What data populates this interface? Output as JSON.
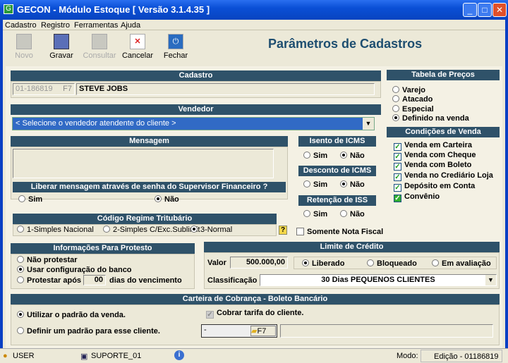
{
  "window": {
    "title": "GECON  -  Módulo Estoque     [ Versão 3.1.4.35 ]",
    "logo": "G"
  },
  "menu": [
    "Cadastro",
    "Registro",
    "Ferramentas",
    "Ajuda"
  ],
  "toolbar": [
    {
      "label": "Novo",
      "icon": "new-icon",
      "enabled": false
    },
    {
      "label": "Gravar",
      "icon": "floppy-icon",
      "enabled": true
    },
    {
      "label": "Consultar",
      "icon": "search-icon",
      "enabled": false
    },
    {
      "label": "Cancelar",
      "icon": "cancel-doc-icon",
      "enabled": true
    },
    {
      "label": "Fechar",
      "icon": "power-icon",
      "enabled": true
    }
  ],
  "page_title": "Parâmetros de Cadastros",
  "cadastro": {
    "header": "Cadastro",
    "code": "01-186819",
    "key": "F7",
    "name": "STEVE JOBS"
  },
  "vendedor": {
    "header": "Vendedor",
    "selected": "< Selecione o vendedor atendente do cliente >"
  },
  "mensagem": {
    "header": "Mensagem",
    "text": ""
  },
  "liberar": {
    "header": "Liberar mensagem através de senha do Supervisor Financeiro ?",
    "options": [
      "Sim",
      "Não"
    ],
    "selected": "Não"
  },
  "isento_icms": {
    "header": "Isento de ICMS",
    "options": [
      "Sim",
      "Não"
    ],
    "selected": "Não"
  },
  "desconto_icms": {
    "header": "Desconto de ICMS",
    "options": [
      "Sim",
      "Não"
    ],
    "selected": "Não"
  },
  "retencao_iss": {
    "header": "Retenção de ISS",
    "options": [
      "Sim",
      "Não"
    ],
    "selected": null
  },
  "tabela_precos": {
    "header": "Tabela de Preços",
    "options": [
      "Varejo",
      "Atacado",
      "Especial",
      "Definido na venda"
    ],
    "selected": "Definido na venda"
  },
  "condicoes_venda": {
    "header": "Condições de Venda",
    "items": [
      {
        "label": "Venda em Carteira",
        "checked": true
      },
      {
        "label": "Venda com Cheque",
        "checked": true
      },
      {
        "label": "Venda com Boleto",
        "checked": true
      },
      {
        "label": "Venda no Crediário Loja",
        "checked": true
      },
      {
        "label": "Depósito em Conta",
        "checked": true
      },
      {
        "label": "Convênio",
        "checked": true
      }
    ]
  },
  "regime": {
    "header": "Código Regime Tritubário",
    "options": [
      "1-Simples Nacional",
      "2-Simples C/Exc.Sublimit",
      "3-Normal"
    ],
    "selected": "3-Normal",
    "help": "?"
  },
  "somente_nota": {
    "label": "Somente Nota Fiscal",
    "checked": false
  },
  "protesto": {
    "header": "Informações Para Protesto",
    "opt1": "Não protestar",
    "opt2": "Usar configuração do banco",
    "opt3": "Protestar após",
    "days": "00",
    "suffix": "dias do vencimento",
    "selected": "Usar configuração do banco"
  },
  "limite": {
    "header": "Limite de Crédito",
    "valor_label": "Valor",
    "valor": "500.000,00",
    "options": [
      "Liberado",
      "Bloqueado",
      "Em avaliação"
    ],
    "selected": "Liberado",
    "class_label": "Classificação",
    "classificacao": "30 Dias  PEQUENOS CLIENTES"
  },
  "carteira": {
    "header": "Carteira de Cobrança - Boleto Bancário",
    "opt1": "Utilizar o padrão da venda.",
    "opt2": "Definir um padrão para esse cliente.",
    "selected": "Utilizar o padrão da venda.",
    "cobrar": "Cobrar tarifa do cliente.",
    "cobrar_checked": true,
    "code": "-",
    "key": "F7"
  },
  "status": {
    "user": "USER",
    "station": "SUPORTE_01",
    "modo_label": "Modo:",
    "modo": "Edição - 01186819"
  }
}
